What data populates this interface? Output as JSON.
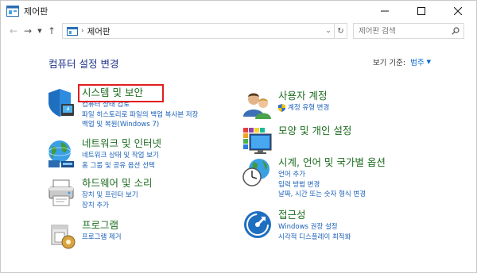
{
  "window": {
    "title": "제어판"
  },
  "address": {
    "crumb": "제어판",
    "search_placeholder": "제어판 검색"
  },
  "main": {
    "heading": "컴퓨터 설정 변경",
    "view_by": {
      "label": "보기 기준:",
      "value": "범주"
    }
  },
  "categories": [
    {
      "title": "시스템 및 보안",
      "links": [
        "컴퓨터 상태 검토",
        "파일 히스토리로 파일의 백업 복사본 저장",
        "백업 및 복원(Windows 7)"
      ]
    },
    {
      "title": "네트워크 및 인터넷",
      "links": [
        "네트워크 상태 및 작업 보기",
        "홈 그룹 및 공유 옵션 선택"
      ]
    },
    {
      "title": "하드웨어 및 소리",
      "links": [
        "장치 및 프린터 보기",
        "장치 추가"
      ]
    },
    {
      "title": "프로그램",
      "links": [
        "프로그램 제거"
      ]
    },
    {
      "title": "사용자 계정",
      "links": [
        "계정 유형 변경"
      ]
    },
    {
      "title": "모양 및 개인 설정",
      "links": []
    },
    {
      "title": "시계, 언어 및 국가별 옵션",
      "links": [
        "언어 추가",
        "입력 방법 변경",
        "날짜, 시간 또는 숫자 형식 변경"
      ]
    },
    {
      "title": "접근성",
      "links": [
        "Windows 권장 설정",
        "시각적 디스플레이 최적화"
      ]
    }
  ],
  "colors": {
    "heading": "#1e3287",
    "category_title": "#1d6c20",
    "link": "#1a5fb8",
    "highlight": "#e31d1d"
  }
}
